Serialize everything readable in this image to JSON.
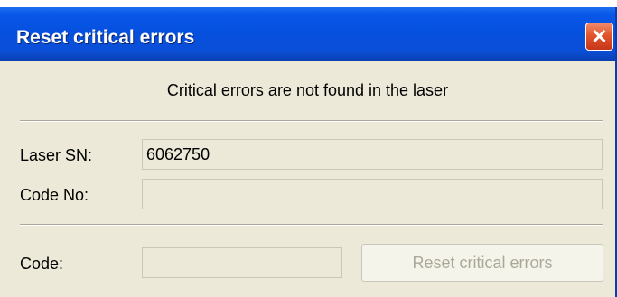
{
  "window": {
    "title": "Reset critical errors",
    "close_glyph": "✕"
  },
  "message": "Critical errors are not found in the laser",
  "fields": {
    "laser_sn": {
      "label": "Laser SN:",
      "value": "6062750"
    },
    "code_no": {
      "label": "Code No:",
      "value": ""
    },
    "code": {
      "label": "Code:",
      "value": ""
    }
  },
  "buttons": {
    "reset_label": "Reset critical errors"
  },
  "colors": {
    "titlebar": "#0550df",
    "dialog_bg": "#ece9d8",
    "close_button": "#e2552c",
    "disabled_text": "#aca899"
  }
}
